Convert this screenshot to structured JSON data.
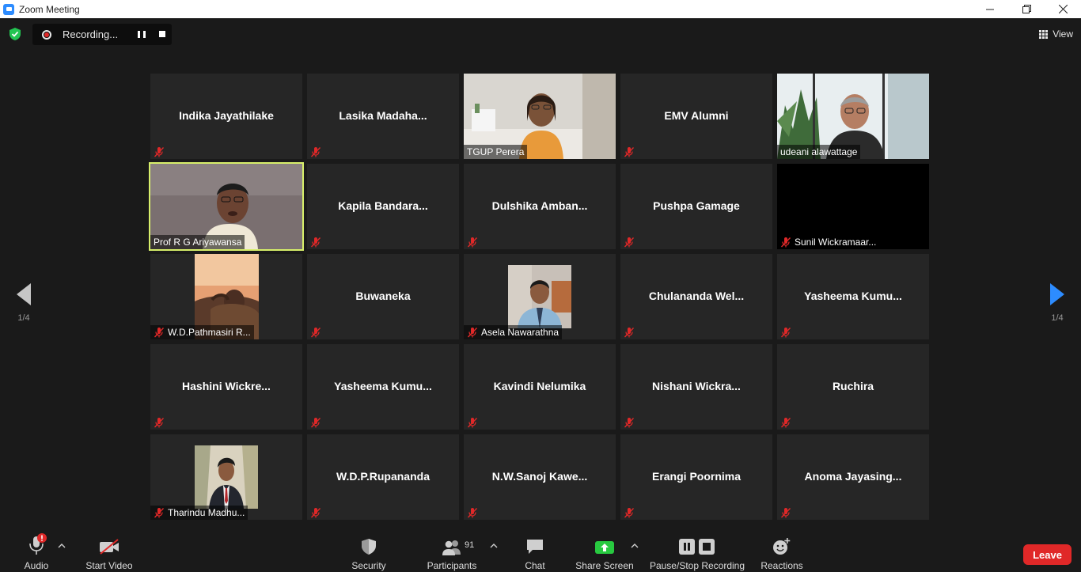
{
  "window": {
    "title": "Zoom Meeting"
  },
  "recording": {
    "label": "Recording..."
  },
  "view": {
    "label": "View"
  },
  "pager": {
    "left": "1/4",
    "right": "1/4"
  },
  "participants_grid": [
    {
      "name": "Indika Jayathilake",
      "muted": true,
      "video": false
    },
    {
      "name": "Lasika  Madaha...",
      "muted": true,
      "video": false
    },
    {
      "name": "TGUP Perera",
      "muted": false,
      "video": true,
      "cam": "woman-desk"
    },
    {
      "name": "EMV Alumni",
      "muted": true,
      "video": false
    },
    {
      "name": "udeani alawattage",
      "muted": false,
      "video": true,
      "cam": "man-plants"
    },
    {
      "name": "Prof R G Ariyawansa",
      "muted": false,
      "video": true,
      "cam": "man-speaking",
      "active": true
    },
    {
      "name": "Kapila  Bandara...",
      "muted": true,
      "video": false
    },
    {
      "name": "Dulshika  Amban...",
      "muted": true,
      "video": false
    },
    {
      "name": "Pushpa Gamage",
      "muted": true,
      "video": false
    },
    {
      "name": "Sunil Wickramaar...",
      "muted": true,
      "video": true,
      "cam": "black"
    },
    {
      "name": "W.D.Pathmasiri R...",
      "muted": true,
      "video": true,
      "cam": "man-portrait-small"
    },
    {
      "name": "Buwaneka",
      "muted": true,
      "video": false
    },
    {
      "name": "Asela Nawarathna",
      "muted": true,
      "video": true,
      "cam": "man-office-small"
    },
    {
      "name": "Chulananda  Wel...",
      "muted": true,
      "video": false
    },
    {
      "name": "Yasheema  Kumu...",
      "muted": true,
      "video": false
    },
    {
      "name": "Hashini  Wickre...",
      "muted": true,
      "video": false
    },
    {
      "name": "Yasheema  Kumu...",
      "muted": true,
      "video": false
    },
    {
      "name": "Kavindi Nelumika",
      "muted": true,
      "video": false
    },
    {
      "name": "Nishani  Wickra...",
      "muted": true,
      "video": false
    },
    {
      "name": "Ruchira",
      "muted": true,
      "video": false
    },
    {
      "name": "Tharindu Madhu...",
      "muted": true,
      "video": true,
      "cam": "man-suit-small"
    },
    {
      "name": "W.D.P.Rupananda",
      "muted": true,
      "video": false
    },
    {
      "name": "N.W.Sanoj  Kawe...",
      "muted": true,
      "video": false
    },
    {
      "name": "Erangi Poornima",
      "muted": true,
      "video": false
    },
    {
      "name": "Anoma  Jayasing...",
      "muted": true,
      "video": false
    }
  ],
  "toolbar": {
    "audio": "Audio",
    "start_video": "Start Video",
    "security": "Security",
    "participants": "Participants",
    "participants_count": "91",
    "chat": "Chat",
    "share_screen": "Share Screen",
    "recording": "Pause/Stop Recording",
    "reactions": "Reactions",
    "leave": "Leave"
  },
  "colors": {
    "accent": "#2d8cff",
    "share": "#28c940",
    "leave": "#e02828",
    "active_speaker": "#d7ef6a",
    "muted": "#e02828"
  }
}
